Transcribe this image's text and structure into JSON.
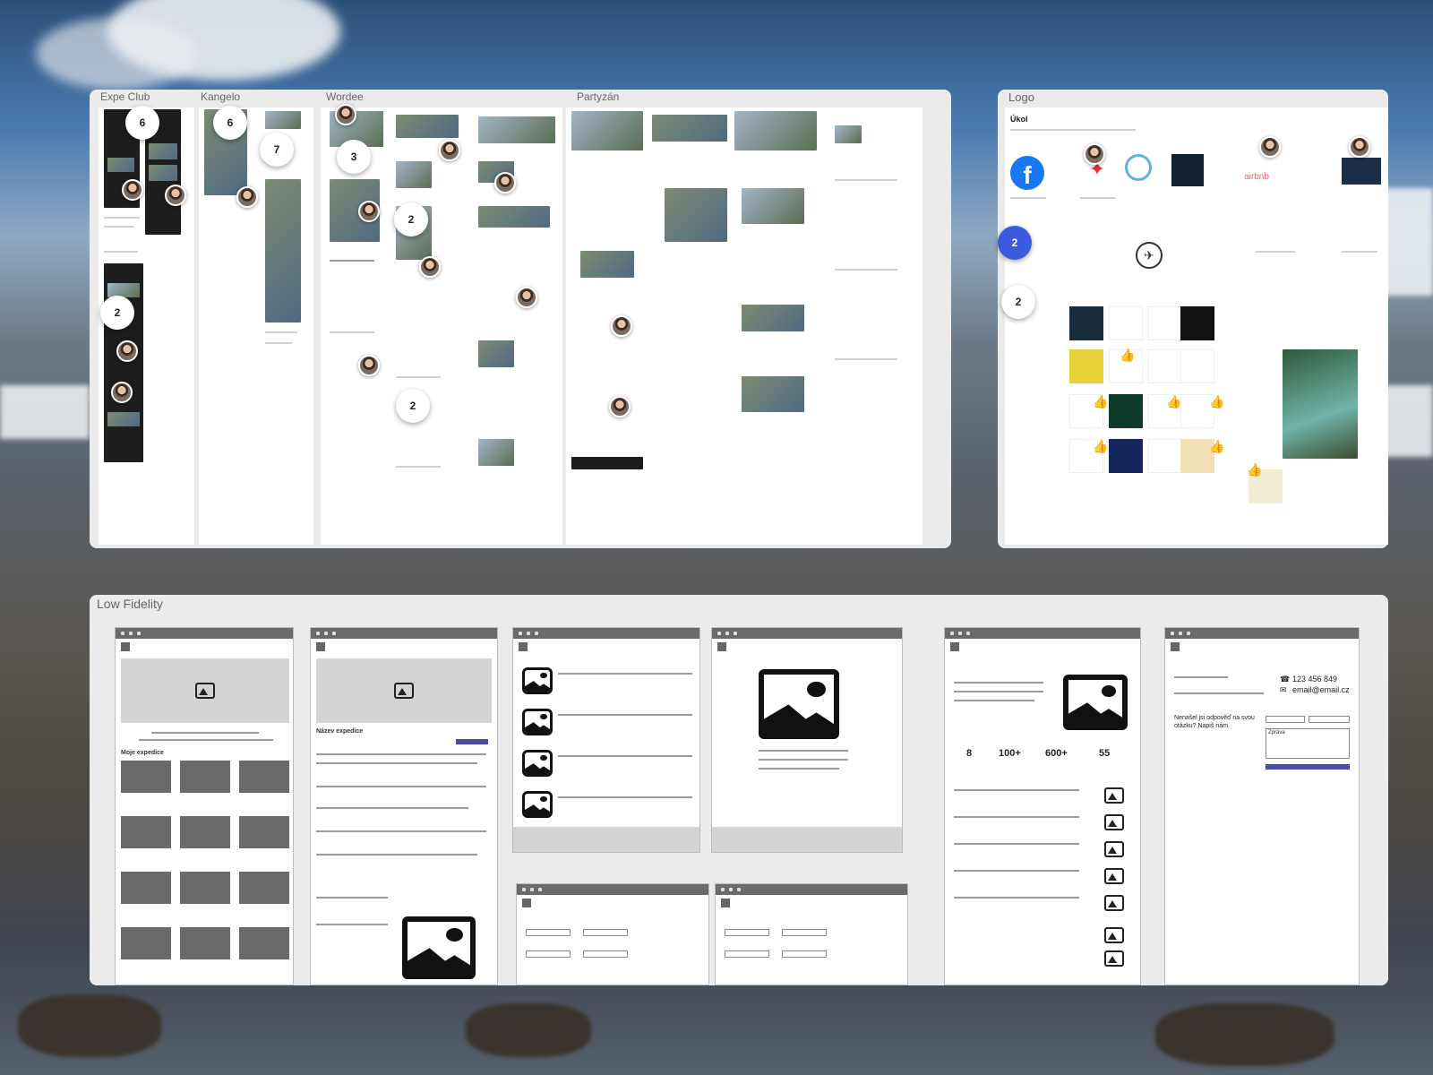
{
  "boards": {
    "research": {
      "frames": [
        "Expe Club",
        "Kangelo",
        "Wordee",
        "Partyzán"
      ]
    },
    "logo": {
      "title": "Logo",
      "task_label": "Úkol"
    },
    "low_fidelity": {
      "title": "Low Fidelity"
    }
  },
  "comment_badges": {
    "expe_top": "6",
    "expe_mid": "2",
    "kangelo_top": "6",
    "kangelo_mid": "7",
    "wordee_a": "3",
    "wordee_b": "2",
    "wordee_c": "2",
    "logo_blue": "2",
    "logo_white": "2"
  },
  "wireframes": {
    "home_section": "Moje expedice",
    "detail_title": "Název expedice",
    "stats": [
      "8",
      "100+",
      "600+",
      "55"
    ],
    "contact_phone": "123 456 849",
    "contact_email": "email@email.cz",
    "contact_prompt": "Nenašel jsi odpověď na svou otázku? Napiš nám.",
    "message_placeholder": "Zpráva"
  },
  "colors": {
    "board": "#ebebeb",
    "badge_blue": "#3d5be0",
    "facebook": "#1877f2",
    "wire_button": "#4a4aa8"
  }
}
